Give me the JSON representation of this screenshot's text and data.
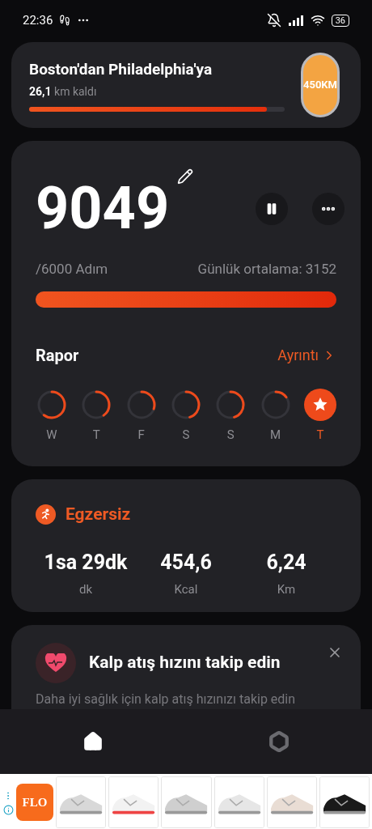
{
  "status_bar": {
    "time": "22:36",
    "battery": "36"
  },
  "journey": {
    "title": "Boston'dan Philadelphia'ya",
    "remaining_value": "26,1",
    "remaining_unit": "km kaldı",
    "level": 0.93,
    "badge": "450KM"
  },
  "steps": {
    "count": "9049",
    "goal": "/6000 Adım",
    "average": "Günlük ortalama: 3152",
    "level": 1
  },
  "report": {
    "title": "Rapor",
    "detail_link": "Ayrıntı",
    "days": [
      {
        "label": "W",
        "done": false,
        "selected": false
      },
      {
        "label": "T",
        "done": false,
        "selected": false
      },
      {
        "label": "F",
        "done": false,
        "selected": false
      },
      {
        "label": "S",
        "done": false,
        "selected": false
      },
      {
        "label": "S",
        "done": false,
        "selected": false
      },
      {
        "label": "M",
        "done": false,
        "selected": false
      },
      {
        "label": "T",
        "done": true,
        "selected": true
      }
    ]
  },
  "exercise": {
    "title": "Egzersiz",
    "stats": [
      {
        "value": "1sa 29dk",
        "unit": "dk"
      },
      {
        "value": "454,6",
        "unit": "Kcal"
      },
      {
        "value": "6,24",
        "unit": "Km"
      }
    ]
  },
  "heart_card": {
    "title": "Kalp atış hızını takip edin",
    "text": "Daha iyi sağlık için kalp atış hızınızı takip edin"
  },
  "nav": [
    {
      "selected": true
    },
    {
      "selected": false
    }
  ],
  "ad": {
    "logo": "FLO"
  }
}
